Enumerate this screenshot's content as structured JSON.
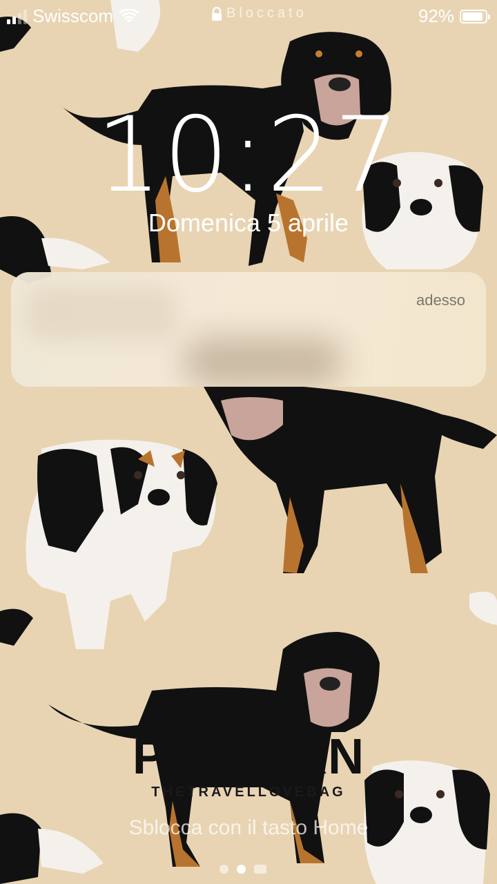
{
  "status_bar": {
    "carrier": "Swisscom",
    "lock_label": "Bloccato",
    "battery_percent": "92%",
    "battery_level": 0.92,
    "signal_bars": 4,
    "signal_active": 2
  },
  "lock_screen": {
    "time": "10:27",
    "date": "Domenica 5 aprile"
  },
  "notification": {
    "time": "adesso"
  },
  "wallpaper": {
    "brand_name": "PATTERN",
    "brand_tagline": "THETRAVELLOVEBAG",
    "background_color": "#E8D4B3"
  },
  "footer": {
    "unlock_hint": "Sblocca con il tasto Home",
    "page_count": 2,
    "active_page": 1
  }
}
